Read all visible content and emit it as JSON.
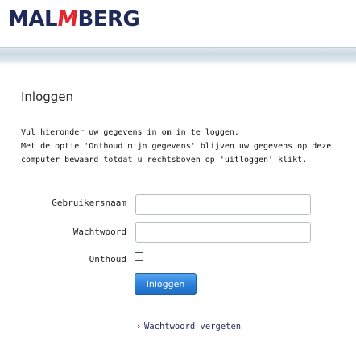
{
  "header": {
    "logo_left": "MAL",
    "logo_mark": "M",
    "logo_right": "BERG"
  },
  "page": {
    "title": "Inloggen",
    "intro_line1": "Vul hieronder uw gegevens in om in te loggen.",
    "intro_line2": "Met de optie 'Onthoud mijn gegevens' blijven uw gegevens op deze",
    "intro_line3": "computer bewaard totdat u rechtsboven op 'uitloggen' klikt."
  },
  "form": {
    "username_label": "Gebruikersnaam",
    "username_value": "",
    "password_label": "Wachtwoord",
    "password_value": "",
    "remember_label": "Onthoud",
    "remember_checked": false,
    "submit_label": "Inloggen"
  },
  "links": {
    "forgot_label": "Wachtwoord vergeten",
    "forgot_icon": "chevron-right-icon"
  },
  "colors": {
    "brand_navy": "#1f2a5a",
    "brand_red": "#e3262f",
    "button_blue": "#2a7fd9"
  }
}
